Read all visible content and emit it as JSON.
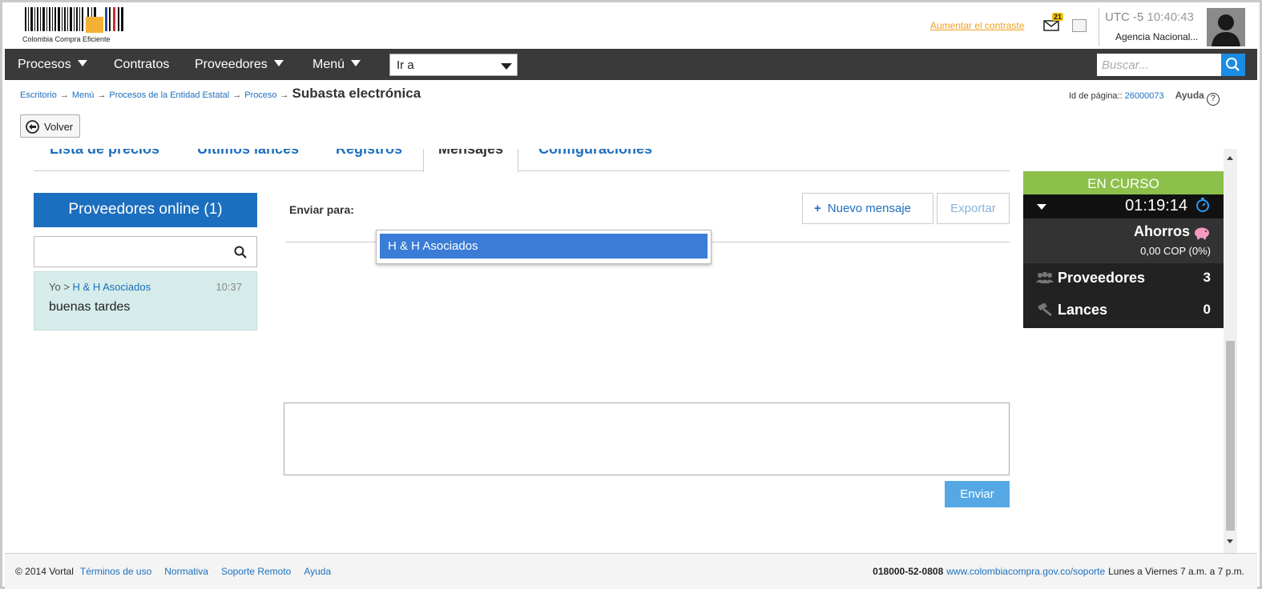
{
  "header": {
    "logo_text": "Colombia Compra Eficiente",
    "contrast_link": "Aumentar el contraste",
    "mail_count": "21",
    "timezone": "UTC -5",
    "time": "10:40:43",
    "agency": "Agencia Nacional..."
  },
  "nav": {
    "items": [
      {
        "label": "Procesos"
      },
      {
        "label": "Contratos"
      },
      {
        "label": "Proveedores"
      },
      {
        "label": "Menú"
      }
    ],
    "goto_label": "Ir a",
    "search_placeholder": "Buscar..."
  },
  "breadcrumb": {
    "items": [
      "Escritorio",
      "Menú",
      "Procesos de la Entidad Estatal",
      "Proceso"
    ],
    "current": "Subasta electrónica"
  },
  "page_id": {
    "label": "Id de página::",
    "value": "26000073",
    "help": "Ayuda"
  },
  "back_button": "Volver",
  "tabs": [
    "Lista de precios",
    "Últimos lances",
    "Registros",
    "Mensajes",
    "Configuraciones"
  ],
  "online": {
    "title": "Proveedores online (1)",
    "message": {
      "from": "Yo",
      "to": "H & H Asociados",
      "time": "10:37",
      "text": "buenas tardes"
    }
  },
  "messages": {
    "send_to_label": "Enviar para:",
    "new_message": "Nuevo mensaje",
    "export": "Exportar",
    "dropdown_option": "H & H Asociados",
    "send": "Enviar"
  },
  "auction": {
    "status": "EN CURSO",
    "timer": "01:19:14",
    "savings_label": "Ahorros",
    "savings_value": "0,00 COP (0%)",
    "suppliers_label": "Proveedores",
    "suppliers_value": "3",
    "bids_label": "Lances",
    "bids_value": "0",
    "status_color": "#8cc04a"
  },
  "footer": {
    "copyright": "© 2014 Vortal",
    "links": [
      "Términos de uso",
      "Normativa",
      "Soporte Remoto",
      "Ayuda"
    ],
    "phone": "018000-52-0808",
    "support_url": "www.colombiacompra.gov.co/soporte",
    "hours": "Lunes a Viernes 7 a.m. a 7 p.m."
  }
}
